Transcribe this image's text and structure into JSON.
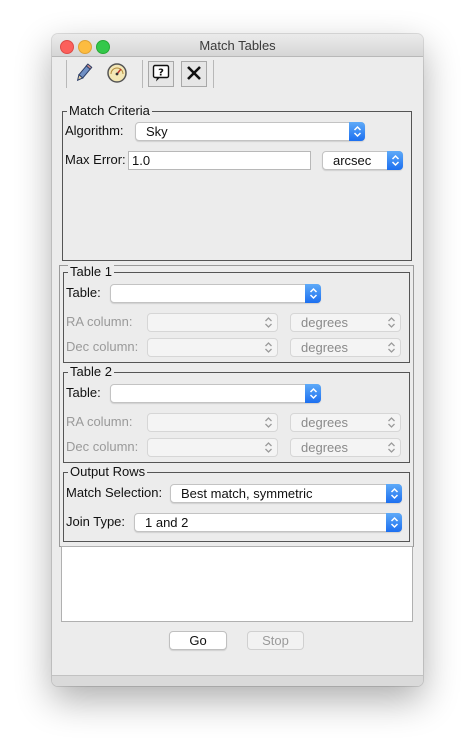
{
  "window": {
    "title": "Match Tables"
  },
  "toolbar": {
    "icons": [
      "pencil-icon",
      "gauge-icon",
      "help-icon",
      "close-icon"
    ]
  },
  "match_criteria": {
    "legend": "Match Criteria",
    "algorithm_label": "Algorithm:",
    "algorithm_value": "Sky",
    "max_error_label": "Max Error:",
    "max_error_value": "1.0",
    "max_error_unit": "arcsec"
  },
  "table1": {
    "legend": "Table 1",
    "table_label": "Table:",
    "table_value": "",
    "ra_label": "RA column:",
    "ra_unit": "degrees",
    "dec_label": "Dec column:",
    "dec_unit": "degrees"
  },
  "table2": {
    "legend": "Table 2",
    "table_label": "Table:",
    "table_value": "",
    "ra_label": "RA column:",
    "ra_unit": "degrees",
    "dec_label": "Dec column:",
    "dec_unit": "degrees"
  },
  "output_rows": {
    "legend": "Output Rows",
    "match_selection_label": "Match Selection:",
    "match_selection_value": "Best match, symmetric",
    "join_type_label": "Join Type:",
    "join_type_value": "1 and 2"
  },
  "buttons": {
    "go_label": "Go",
    "stop_label": "Stop"
  },
  "colors": {
    "accent": "#1c6ff0",
    "close": "#fc605c",
    "minimize": "#fdbc40",
    "zoom": "#34c84a"
  }
}
